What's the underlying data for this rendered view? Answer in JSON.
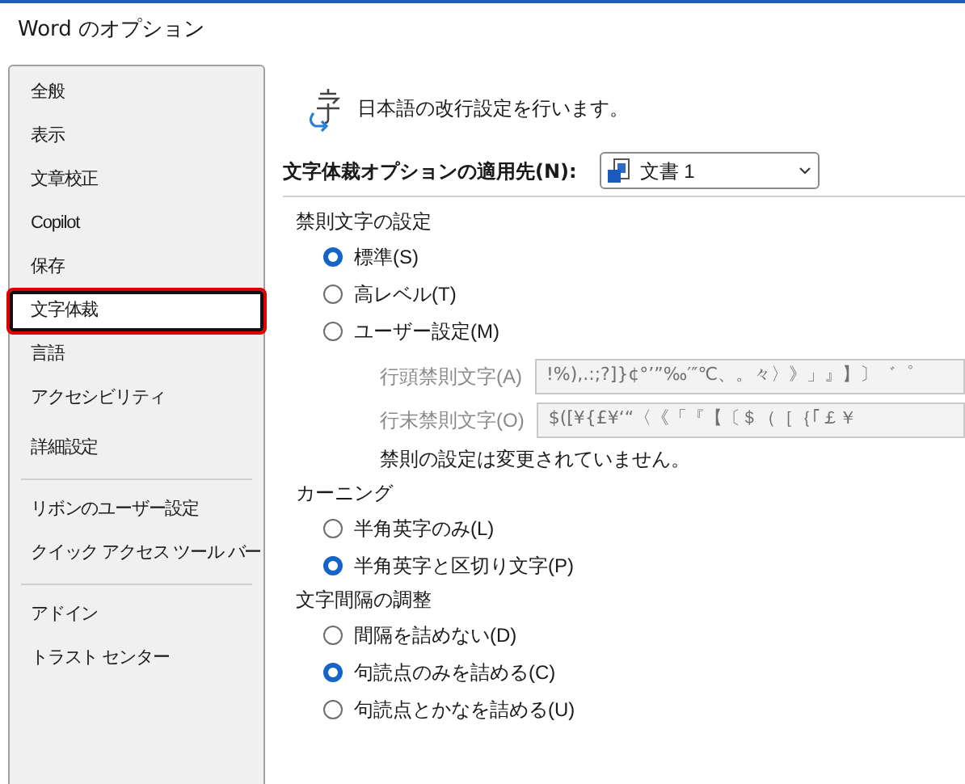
{
  "window": {
    "title": "Word のオプション"
  },
  "sidebar": {
    "groups": [
      {
        "items": [
          {
            "label": "全般",
            "selected": false
          },
          {
            "label": "表示",
            "selected": false
          },
          {
            "label": "文章校正",
            "selected": false
          },
          {
            "label": "Copilot",
            "selected": false
          },
          {
            "label": "保存",
            "selected": false
          },
          {
            "label": "文字体裁",
            "selected": true
          },
          {
            "label": "言語",
            "selected": false
          },
          {
            "label": "アクセシビリティ",
            "selected": false
          },
          {
            "label": "詳細設定",
            "selected": false
          }
        ]
      },
      {
        "items": [
          {
            "label": "リボンのユーザー設定",
            "selected": false
          },
          {
            "label": "クイック アクセス ツール バー",
            "selected": false
          }
        ]
      },
      {
        "items": [
          {
            "label": "アドイン",
            "selected": false
          },
          {
            "label": "トラスト センター",
            "selected": false
          }
        ]
      }
    ]
  },
  "header": {
    "text": "日本語の改行設定を行います。"
  },
  "apply_to": {
    "label": "文字体裁オプションの適用先(N):",
    "value": "文書 1"
  },
  "sections": [
    {
      "title": "禁則文字の設定",
      "options": [
        {
          "label": "標準(S)",
          "selected": true
        },
        {
          "label": "高レベル(T)",
          "selected": false
        },
        {
          "label": "ユーザー設定(M)",
          "selected": false
        }
      ],
      "fields": [
        {
          "label": "行頭禁則文字(A)",
          "value": "!%),.:;?]}¢°’”‰′″℃、。々〉》」』】〕゛゜",
          "disabled": true
        },
        {
          "label": "行末禁則文字(O)",
          "value": "$([¥{£¥‘“〈《「『【〔＄（［｛｢￡￥",
          "disabled": true
        }
      ],
      "note": "禁則の設定は変更されていません。"
    },
    {
      "title": "カーニング",
      "options": [
        {
          "label": "半角英字のみ(L)",
          "selected": false
        },
        {
          "label": "半角英字と区切り文字(P)",
          "selected": true
        }
      ]
    },
    {
      "title": "文字間隔の調整",
      "options": [
        {
          "label": "間隔を詰めない(D)",
          "selected": false
        },
        {
          "label": "句読点のみを詰める(C)",
          "selected": true
        },
        {
          "label": "句読点とかなを詰める(U)",
          "selected": false
        }
      ]
    }
  ]
}
